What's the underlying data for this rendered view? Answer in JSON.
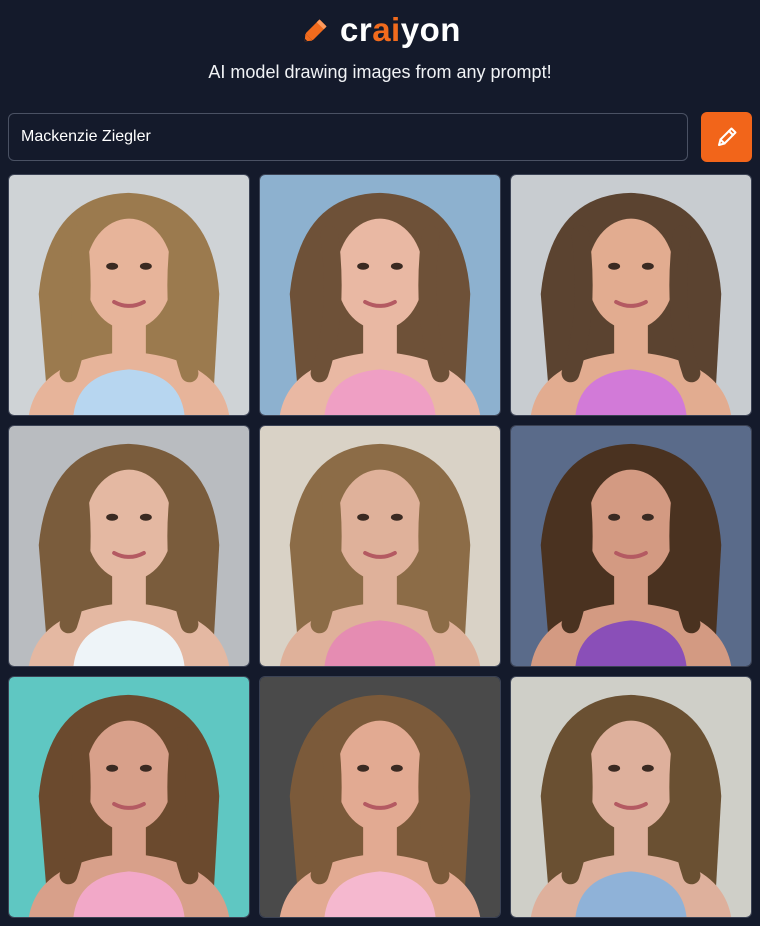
{
  "app": {
    "logo_prefix": "cr",
    "logo_accent": "ai",
    "logo_suffix": "yon",
    "tagline": "AI model drawing images from any prompt!",
    "accent_color": "#f26b1d",
    "background_color": "#141a2b"
  },
  "prompt": {
    "value": "Mackenzie Ziegler",
    "button_icon": "pencil-icon"
  },
  "results": {
    "count": 9,
    "images": [
      {
        "bg": "#cfd3d6",
        "hair": "#9b7a4e",
        "skin": "#e7b49a",
        "shirt": "#b7d6f0"
      },
      {
        "bg": "#8db1cf",
        "hair": "#6e5138",
        "skin": "#e9b8a3",
        "shirt": "#ef9fc4"
      },
      {
        "bg": "#c8ccd0",
        "hair": "#5b4330",
        "skin": "#e2ac90",
        "shirt": "#d27ad8"
      },
      {
        "bg": "#b9bcc0",
        "hair": "#7a5c3c",
        "skin": "#e4b8a2",
        "shirt": "#eef4f8"
      },
      {
        "bg": "#d9d2c6",
        "hair": "#8c6c47",
        "skin": "#dfb19a",
        "shirt": "#e58cb2"
      },
      {
        "bg": "#5a6b8a",
        "hair": "#4a3220",
        "skin": "#d39a82",
        "shirt": "#8a4fb8"
      },
      {
        "bg": "#5fc7c2",
        "hair": "#6b4a2e",
        "skin": "#d8a08a",
        "shirt": "#f2a8c8"
      },
      {
        "bg": "#4a4a4a",
        "hair": "#7b5a3a",
        "skin": "#e2aa92",
        "shirt": "#f5b8cf"
      },
      {
        "bg": "#cfcfc8",
        "hair": "#6a5032",
        "skin": "#deb09c",
        "shirt": "#8fb2d8"
      }
    ]
  }
}
